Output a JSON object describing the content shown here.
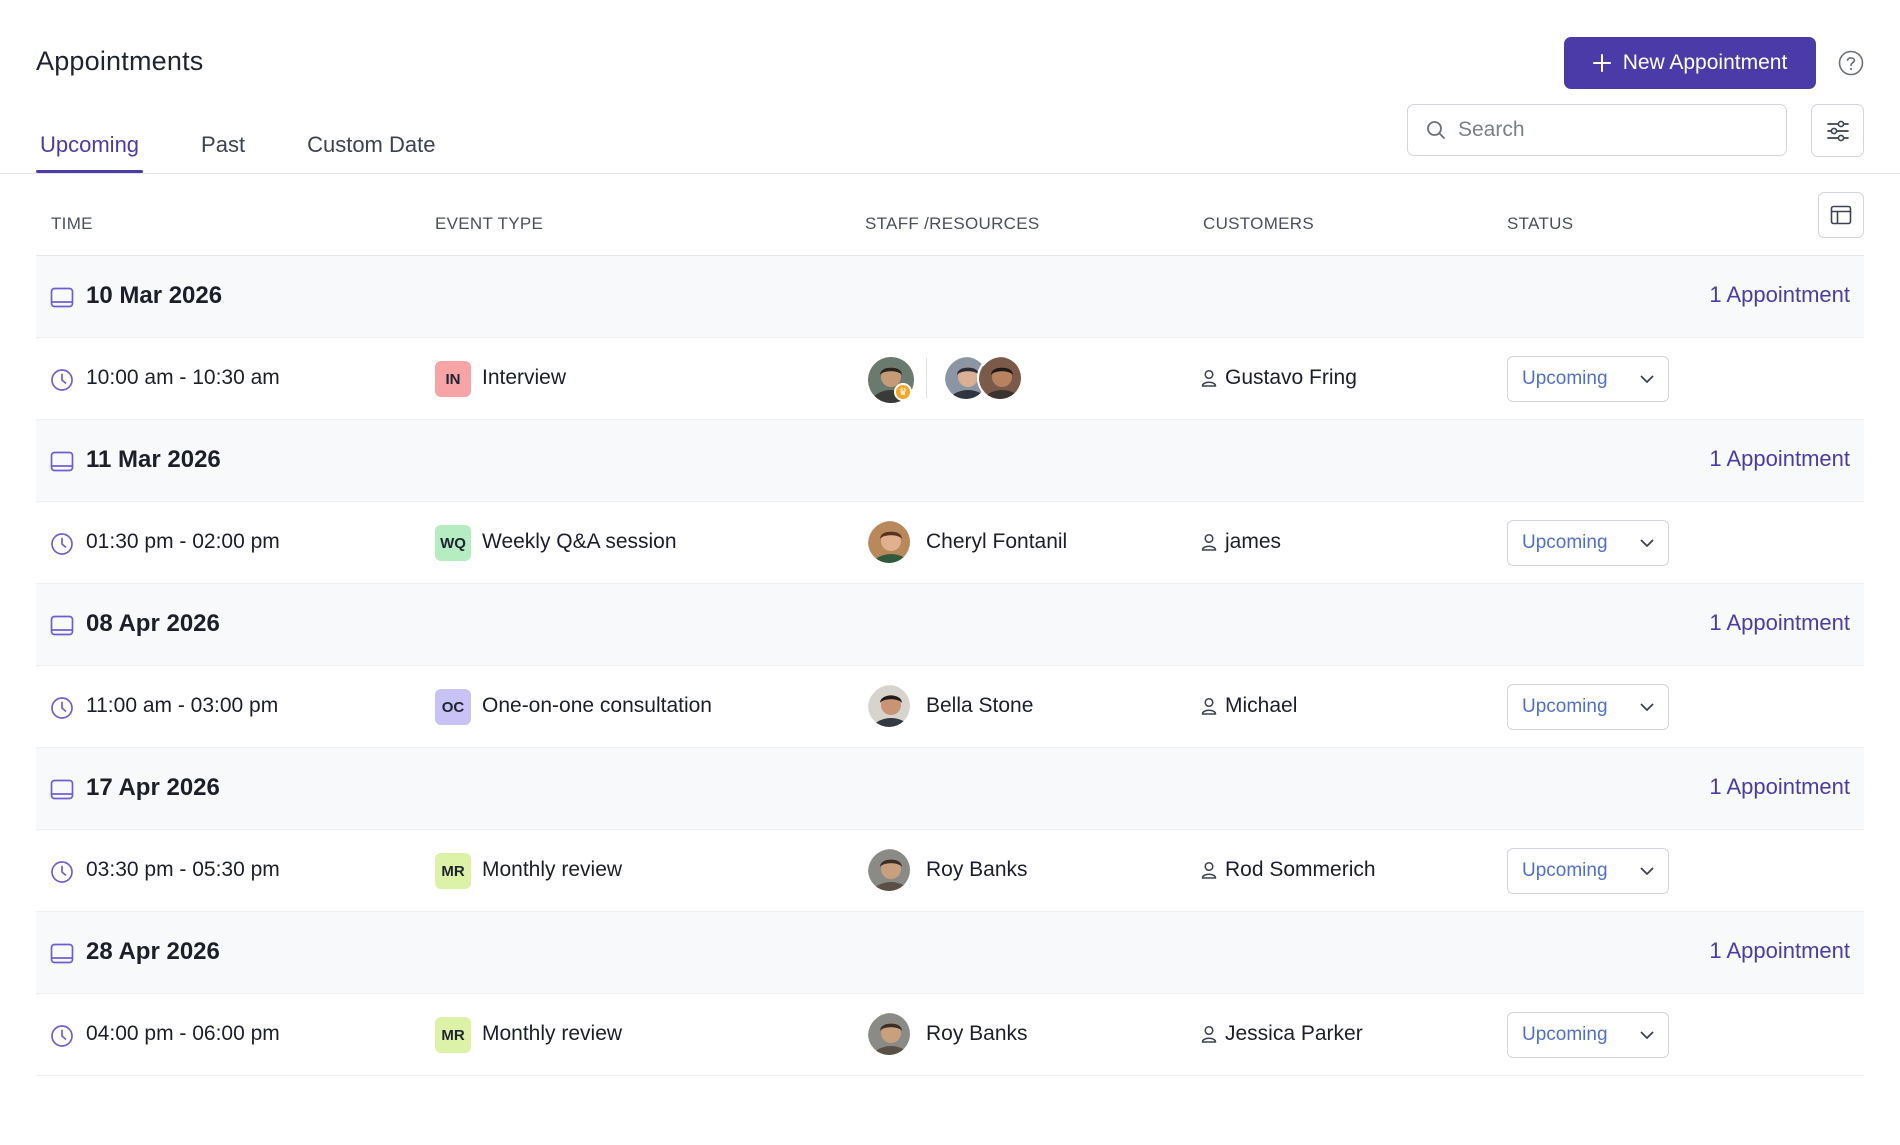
{
  "header": {
    "title": "Appointments",
    "new_button_label": "New Appointment"
  },
  "tabs": [
    {
      "label": "Upcoming",
      "active": true
    },
    {
      "label": "Past",
      "active": false
    },
    {
      "label": "Custom Date",
      "active": false
    }
  ],
  "search": {
    "placeholder": "Search",
    "value": ""
  },
  "table": {
    "columns": [
      "TIME",
      "EVENT TYPE",
      "STAFF /RESOURCES",
      "CUSTOMERS",
      "STATUS"
    ]
  },
  "groups": [
    {
      "date": "10 Mar 2026",
      "count_label": "1 Appointment",
      "appointment": {
        "time": "10:00 am - 10:30 am",
        "event_code": "IN",
        "event_type": "Interview",
        "badge_color": "#f7a4a6",
        "staff_name": "",
        "customer": "Gustavo Fring",
        "status": "Upcoming"
      }
    },
    {
      "date": "11 Mar 2026",
      "count_label": "1 Appointment",
      "appointment": {
        "time": "01:30 pm - 02:00 pm",
        "event_code": "WQ",
        "event_type": "Weekly Q&A session",
        "badge_color": "#b6ecc1",
        "staff_name": "Cheryl Fontanil",
        "customer": "james",
        "status": "Upcoming"
      }
    },
    {
      "date": "08 Apr 2026",
      "count_label": "1 Appointment",
      "appointment": {
        "time": "11:00 am - 03:00 pm",
        "event_code": "OC",
        "event_type": "One-on-one consultation",
        "badge_color": "#c8c2f5",
        "staff_name": "Bella Stone",
        "customer": "Michael",
        "status": "Upcoming"
      }
    },
    {
      "date": "17 Apr 2026",
      "count_label": "1 Appointment",
      "appointment": {
        "time": "03:30 pm - 05:30 pm",
        "event_code": "MR",
        "event_type": "Monthly review",
        "badge_color": "#dcf2a6",
        "staff_name": "Roy Banks",
        "customer": "Rod Sommerich",
        "status": "Upcoming"
      }
    },
    {
      "date": "28 Apr 2026",
      "count_label": "1 Appointment",
      "appointment": {
        "time": "04:00 pm - 06:00 pm",
        "event_code": "MR",
        "event_type": "Monthly review",
        "badge_color": "#dcf2a6",
        "staff_name": "Roy Banks",
        "customer": "Jessica Parker",
        "status": "Upcoming"
      }
    }
  ],
  "colors": {
    "accent": "#4b3ba8",
    "status_text": "#4f6fd0"
  }
}
